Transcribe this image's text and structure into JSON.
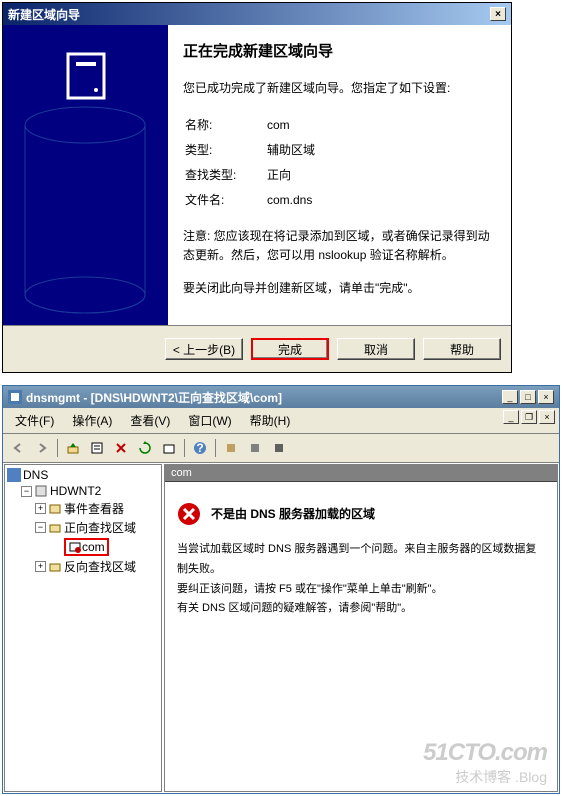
{
  "wizard": {
    "title": "新建区域向导",
    "close_x": "×",
    "heading": "正在完成新建区域向导",
    "intro": "您已成功完成了新建区域向导。您指定了如下设置:",
    "rows": {
      "name_label": "名称:",
      "name_value": "com",
      "type_label": "类型:",
      "type_value": "辅助区域",
      "lookup_label": "查找类型:",
      "lookup_value": "正向",
      "file_label": "文件名:",
      "file_value": "com.dns"
    },
    "note": "注意: 您应该现在将记录添加到区域，或者确保记录得到动态更新。然后，您可以用 nslookup 验证名称解析。",
    "final": "要关闭此向导并创建新区域，请单击\"完成\"。",
    "buttons": {
      "back": "< 上一步(B)",
      "finish": "完成",
      "cancel": "取消",
      "help": "帮助"
    }
  },
  "mmc": {
    "title": "dnsmgmt - [DNS\\HDWNT2\\正向查找区域\\com]",
    "min": "_",
    "max": "□",
    "close": "×",
    "menu": {
      "file": "文件(F)",
      "action": "操作(A)",
      "view": "查看(V)",
      "window": "窗口(W)",
      "help": "帮助(H)"
    },
    "tree": {
      "root": "DNS",
      "server": "HDWNT2",
      "eventviewer": "事件查看器",
      "forward": "正向查找区域",
      "com": "com",
      "reverse": "反向查找区域"
    },
    "detail": {
      "header": "com",
      "error_title": "不是由 DNS 服务器加载的区域",
      "line1": "当尝试加载区域时 DNS 服务器遇到一个问题。来自主服务器的区域数据复制失败。",
      "line2": "要纠正该问题，请按 F5 或在\"操作\"菜单上单击\"刷新\"。",
      "line3": "有关 DNS 区域问题的疑难解答，请参阅\"帮助\"。"
    },
    "watermark": {
      "main": "51CTO.com",
      "sub": "技术博客 .Blog"
    }
  }
}
